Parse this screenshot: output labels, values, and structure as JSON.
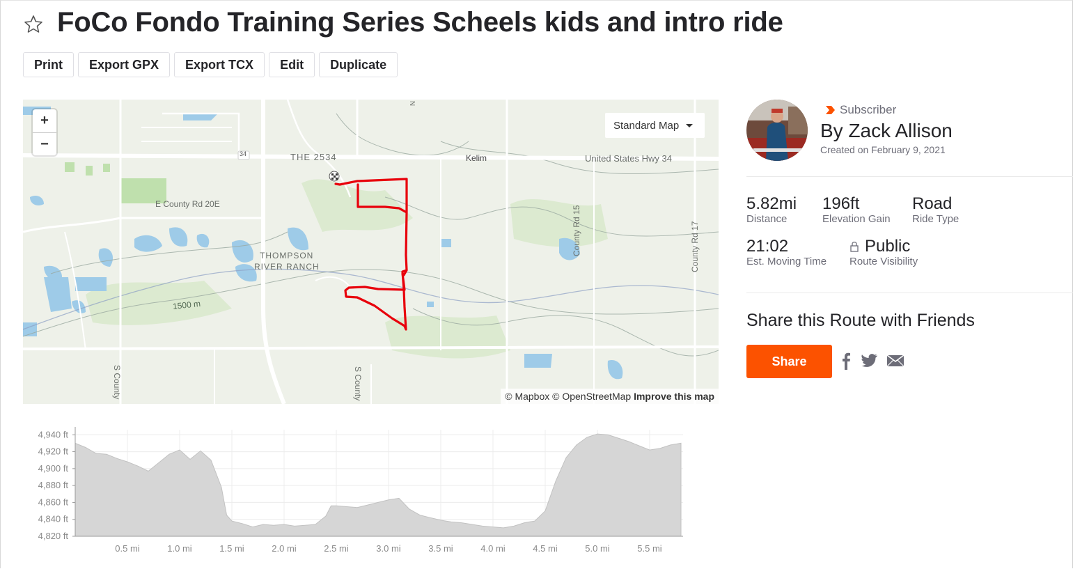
{
  "page": {
    "title": "FoCo Fondo Training Series Scheels kids and intro ride"
  },
  "toolbar": {
    "print": "Print",
    "export_gpx": "Export GPX",
    "export_tcx": "Export TCX",
    "edit": "Edit",
    "duplicate": "Duplicate"
  },
  "map": {
    "zoom_in": "+",
    "zoom_out": "−",
    "map_type": "Standard Map",
    "labels": {
      "the2534": "THE 2534",
      "kelim": "Kelim",
      "hwy34": "United States Hwy 34",
      "hwy34_shield": "34",
      "county20e": "E County Rd 20E",
      "thompson1": "THOMPSON",
      "thompson2": "RIVER RANCH",
      "contour": "1500 m",
      "county15": "County Rd 15",
      "county17": "County Rd 17",
      "scounty1": "S County",
      "scounty2": "S County",
      "north": "N"
    },
    "attribution": {
      "mapbox": "© Mapbox",
      "osm": "© OpenStreetMap",
      "improve": "Improve this map"
    }
  },
  "athlete": {
    "badge": "Subscriber",
    "name": "By Zack Allison",
    "created": "Created on February 9, 2021"
  },
  "stats": {
    "distance_value": "5.82mi",
    "distance_label": "Distance",
    "elevation_value": "196ft",
    "elevation_label": "Elevation Gain",
    "type_value": "Road",
    "type_label": "Ride Type",
    "time_value": "21:02",
    "time_label": "Est. Moving Time",
    "visibility_value": "Public",
    "visibility_label": "Route Visibility"
  },
  "share": {
    "heading": "Share this Route with Friends",
    "button": "Share"
  },
  "colors": {
    "brand": "#fc5200",
    "route": "#e8000b",
    "elevation_fill": "#d6d6d6"
  },
  "chart_data": {
    "type": "area",
    "x": [
      0.0,
      0.1,
      0.2,
      0.3,
      0.4,
      0.5,
      0.6,
      0.7,
      0.8,
      0.9,
      1.0,
      1.1,
      1.2,
      1.3,
      1.4,
      1.45,
      1.5,
      1.6,
      1.7,
      1.8,
      1.9,
      2.0,
      2.1,
      2.2,
      2.3,
      2.4,
      2.45,
      2.5,
      2.6,
      2.7,
      2.8,
      2.9,
      3.0,
      3.1,
      3.2,
      3.3,
      3.4,
      3.5,
      3.6,
      3.7,
      3.8,
      3.9,
      4.0,
      4.1,
      4.2,
      4.3,
      4.4,
      4.5,
      4.6,
      4.7,
      4.8,
      4.9,
      5.0,
      5.1,
      5.2,
      5.3,
      5.4,
      5.5,
      5.6,
      5.7,
      5.8
    ],
    "y": [
      4930,
      4925,
      4918,
      4917,
      4912,
      4908,
      4903,
      4897,
      4907,
      4917,
      4922,
      4911,
      4921,
      4910,
      4878,
      4845,
      4838,
      4835,
      4831,
      4834,
      4833,
      4834,
      4832,
      4833,
      4834,
      4844,
      4856,
      4856,
      4855,
      4854,
      4857,
      4860,
      4863,
      4865,
      4852,
      4845,
      4842,
      4839,
      4837,
      4836,
      4834,
      4832,
      4831,
      4830,
      4832,
      4836,
      4838,
      4850,
      4885,
      4913,
      4928,
      4937,
      4941,
      4940,
      4936,
      4932,
      4927,
      4922,
      4924,
      4928,
      4930
    ],
    "xlabel": "",
    "ylabel": "",
    "xticks": [
      0.5,
      1.0,
      1.5,
      2.0,
      2.5,
      3.0,
      3.5,
      4.0,
      4.5,
      5.0,
      5.5
    ],
    "xtick_labels": [
      "0.5 mi",
      "1.0 mi",
      "1.5 mi",
      "2.0 mi",
      "2.5 mi",
      "3.0 mi",
      "3.5 mi",
      "4.0 mi",
      "4.5 mi",
      "5.0 mi",
      "5.5 mi"
    ],
    "yticks": [
      4820,
      4840,
      4860,
      4880,
      4900,
      4920,
      4940
    ],
    "ytick_labels": [
      "4,820 ft",
      "4,840 ft",
      "4,860 ft",
      "4,880 ft",
      "4,900 ft",
      "4,920 ft",
      "4,940 ft"
    ],
    "xlim": [
      0,
      5.82
    ],
    "ylim": [
      4820,
      4946
    ],
    "grid": true
  }
}
